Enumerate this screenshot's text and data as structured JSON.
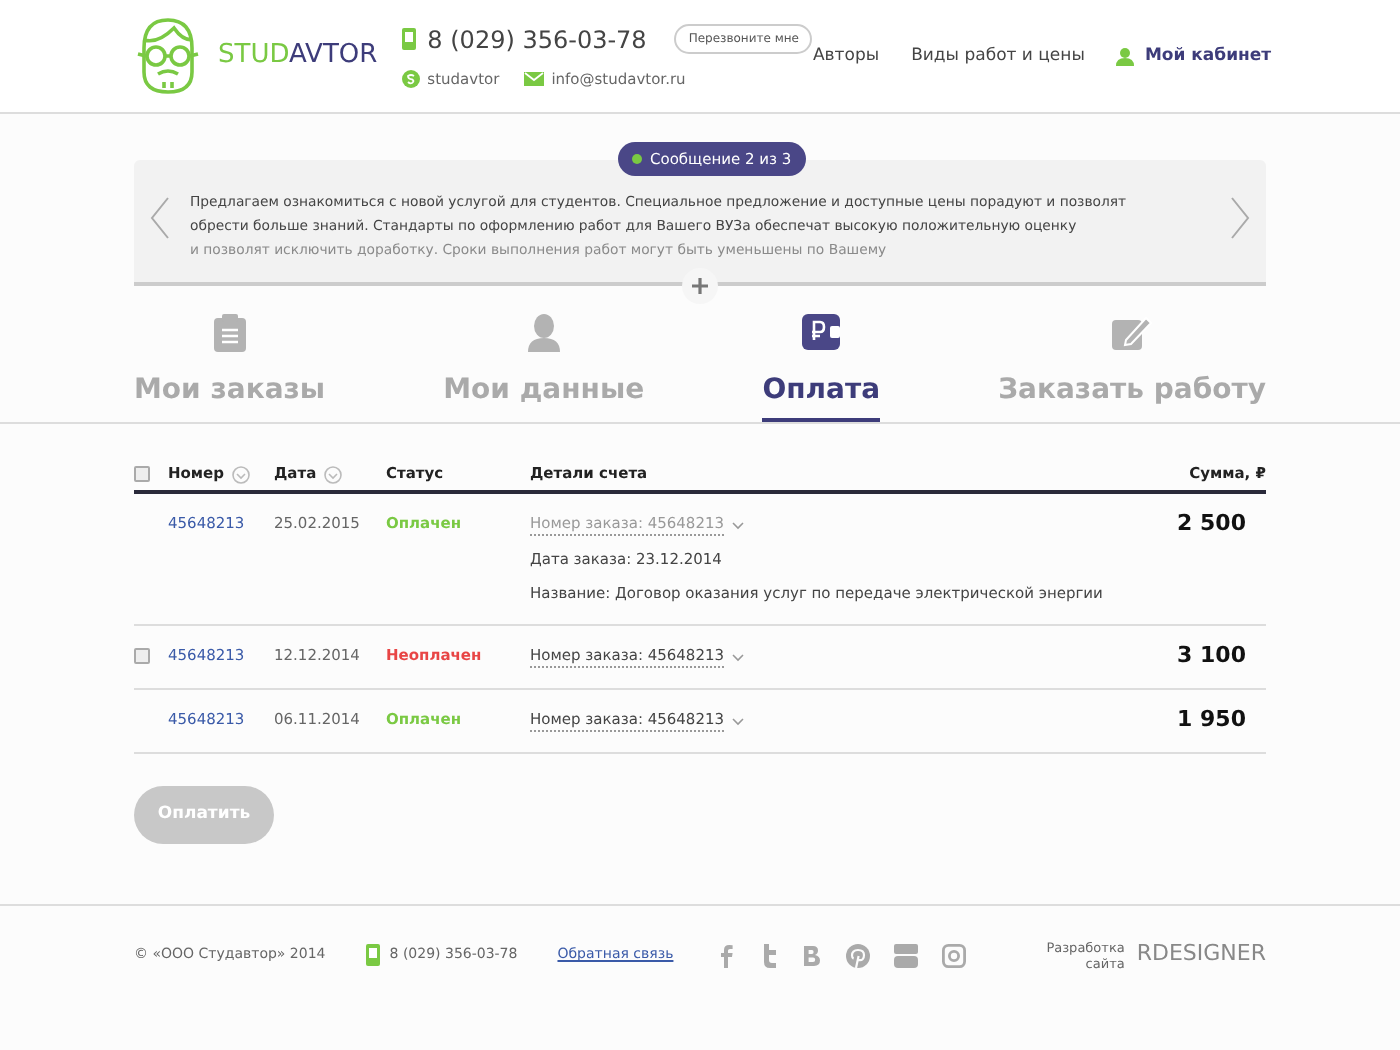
{
  "header": {
    "logo": {
      "part_1": "STUD",
      "part_2": "AVTOR"
    },
    "phone": "8 (029) 356-03-78",
    "callback_button": "Перезвоните мне",
    "skype": "studavtor",
    "email": "info@studavtor.ru",
    "nav": [
      {
        "label": "Авторы",
        "kind": "link"
      },
      {
        "label": "Виды работ и цены",
        "kind": "link"
      },
      {
        "label": "Мой кабинет",
        "kind": "account"
      }
    ]
  },
  "message": {
    "badge": "Сообщение 2 из 3",
    "lines": [
      "Предлагаем ознакомиться с новой услугой для студентов. Специальное предложение и доступные цены порадуют и позволят",
      "обрести больше знаний. Стандарты по оформлению работ для Вашего ВУЗа обеспечат высокую положительную оценку",
      "и позволят исключить доработку. Сроки выполнения работ могут быть уменьшены по Вашему"
    ]
  },
  "tabs": [
    {
      "label": "Мои заказы",
      "kind": "orders",
      "selected": false
    },
    {
      "label": "Мои данные",
      "kind": "profile",
      "selected": false
    },
    {
      "label": "Оплата",
      "kind": "payment",
      "selected": true
    },
    {
      "label": "Заказать работу",
      "kind": "order",
      "selected": false
    }
  ],
  "table": {
    "header_checked": false,
    "columns": [
      "Номер",
      "Дата",
      "Статус",
      "Детали счета",
      "Сумма, ₽"
    ],
    "rows": [
      {
        "checkbox": false,
        "number": "45648213",
        "date": "25.02.2015",
        "status": "Оплачен",
        "paid": true,
        "order": "Номер заказа: 45648213",
        "expanded": true,
        "details": [
          "Дата заказа: 23.12.2014",
          "Название: Договор оказания услуг по передаче электрической энергии"
        ],
        "sum": "2 500"
      },
      {
        "checkbox": true,
        "checked": false,
        "number": "45648213",
        "date": "12.12.2014",
        "status": "Неоплачен",
        "paid": false,
        "order": "Номер заказа: 45648213",
        "expanded": false,
        "sum": "3 100"
      },
      {
        "checkbox": false,
        "number": "45648213",
        "date": "06.11.2014",
        "status": "Оплачен",
        "paid": true,
        "order": "Номер заказа: 45648213",
        "expanded": false,
        "sum": "1 950"
      }
    ]
  },
  "pay_button": {
    "label": "Оплатить",
    "disabled": true
  },
  "footer": {
    "copyright": "© «ООО Студавтор» 2014",
    "phone": "8 (029) 356-03-78",
    "feedback": "Обратная связь",
    "dev_label": [
      "Разработка",
      "сайта"
    ],
    "dev_name": "RDESIGNER"
  }
}
